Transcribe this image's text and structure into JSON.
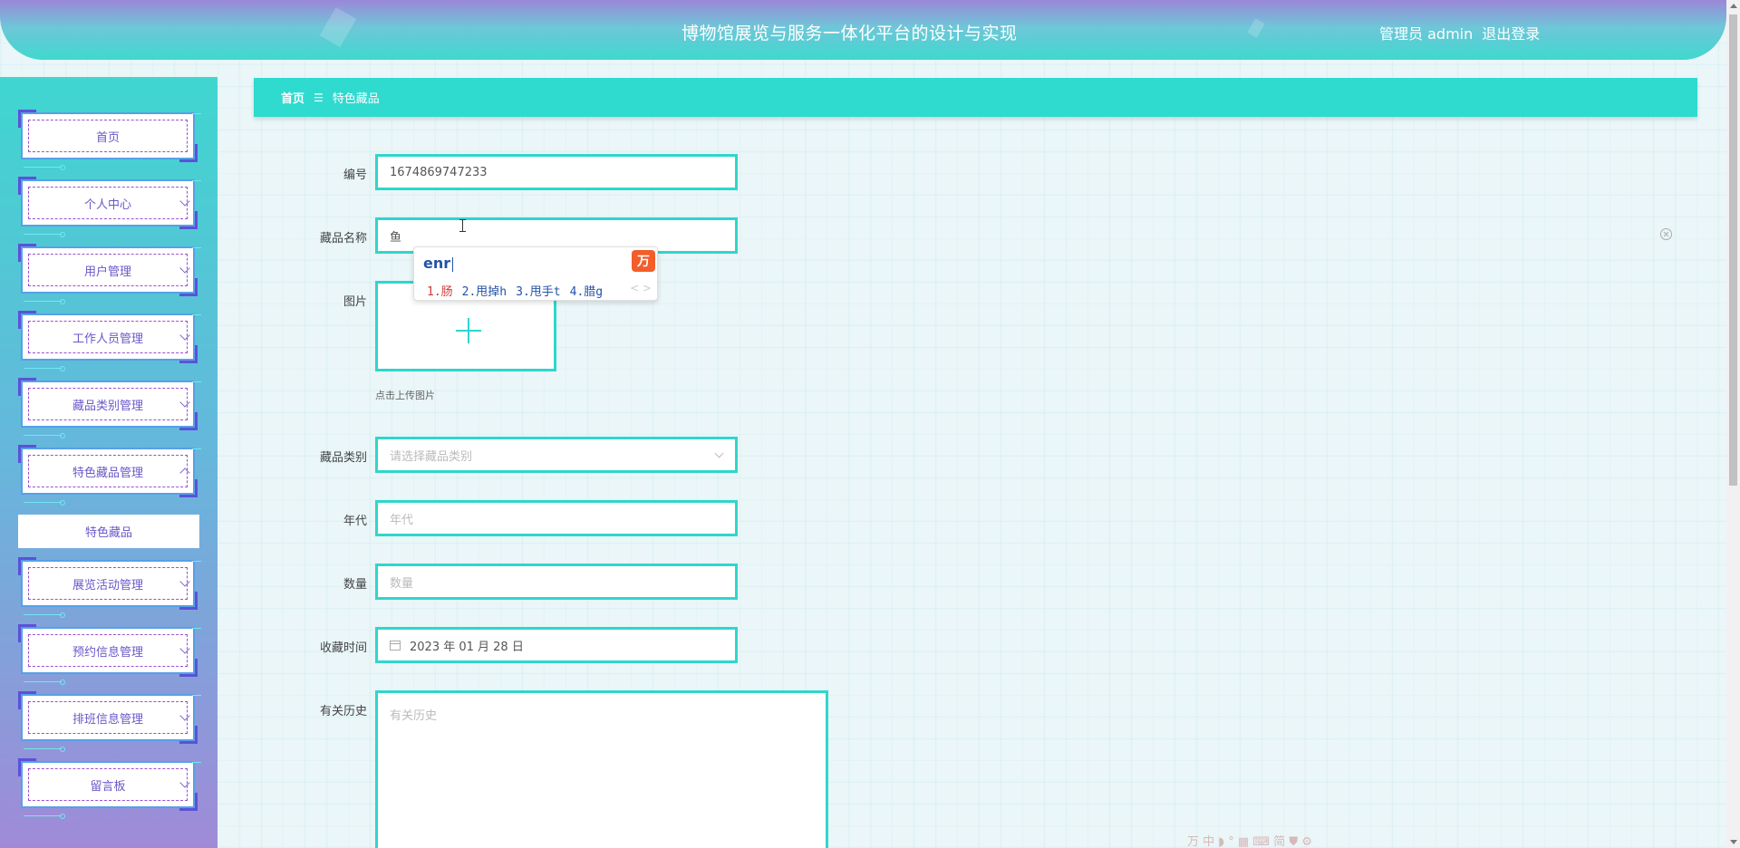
{
  "header": {
    "title": "博物馆展览与服务一体化平台的设计与实现",
    "role": "管理员",
    "username": "admin",
    "logout": "退出登录"
  },
  "sidebar": {
    "items": [
      {
        "label": "首页"
      },
      {
        "label": "个人中心"
      },
      {
        "label": "用户管理"
      },
      {
        "label": "工作人员管理"
      },
      {
        "label": "藏品类别管理"
      },
      {
        "label": "特色藏品管理"
      },
      {
        "label": "展览活动管理"
      },
      {
        "label": "预约信息管理"
      },
      {
        "label": "排班信息管理"
      },
      {
        "label": "留言板"
      }
    ],
    "active_submenu": "特色藏品"
  },
  "breadcrumb": {
    "home": "首页",
    "separator": "☰",
    "current": "特色藏品"
  },
  "form": {
    "code": {
      "label": "编号",
      "value": "1674869747233"
    },
    "name": {
      "label": "藏品名称",
      "value": "鱼"
    },
    "image": {
      "label": "图片",
      "hint": "点击上传图片"
    },
    "category": {
      "label": "藏品类别",
      "placeholder": "请选择藏品类别"
    },
    "era": {
      "label": "年代",
      "placeholder": "年代"
    },
    "quantity": {
      "label": "数量",
      "placeholder": "数量"
    },
    "collected_time": {
      "label": "收藏时间",
      "value": "2023 年 01 月 28 日"
    },
    "history": {
      "label": "有关历史",
      "placeholder": "有关历史"
    }
  },
  "ime": {
    "composition": "enr",
    "logo": "万",
    "candidates": [
      "1.肠",
      "2.甩掉h",
      "3.甩手t",
      "4.腊g"
    ],
    "nav": "< >",
    "toolbar": "万 中 ◗ ° ▦ ⌨ 简 ⛊ ⚙"
  },
  "colors": {
    "accent": "#2fd6cb",
    "sidebar_text": "#6a58c8",
    "header_gradient_top": "#9b87d8"
  }
}
